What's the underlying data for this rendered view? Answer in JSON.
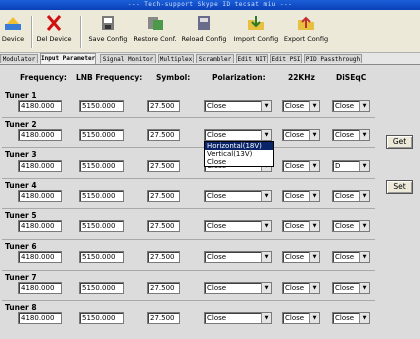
{
  "window": {
    "title": "--- Tech-support Skype ID tecsat miu ---"
  },
  "toolbar": [
    {
      "label": "Device",
      "icon": "add-device-icon"
    },
    {
      "label": "Del Device",
      "icon": "delete-device-icon"
    },
    {
      "label": "Save Config",
      "icon": "save-config-icon"
    },
    {
      "label": "Restore Conf.",
      "icon": "restore-config-icon"
    },
    {
      "label": "Reload Config",
      "icon": "reload-config-icon"
    },
    {
      "label": "Import Config",
      "icon": "import-config-icon"
    },
    {
      "label": "Export Config",
      "icon": "export-config-icon"
    }
  ],
  "tabs": [
    "Modulator",
    "Input Parameter",
    "Signal Monitor",
    "Multiplex",
    "Scrambler",
    "Edit NIT",
    "Edit PSI",
    "PID Passthrough"
  ],
  "active_tab": "Input Parameter",
  "headers": {
    "frequency": "Frequency:",
    "lnb": "LNB Frequency:",
    "symbol": "Symbol:",
    "polarization": "Polarization:",
    "khz": "22KHz",
    "diseqc": "DiSEqC"
  },
  "tuners": [
    {
      "label": "Tuner 1",
      "frequency": "4180.000",
      "lnb": "5150.000",
      "symbol": "27.500",
      "polarization": "Close",
      "khz": "Close",
      "diseqc": "Close"
    },
    {
      "label": "Tuner 2",
      "frequency": "4180.000",
      "lnb": "5150.000",
      "symbol": "27.500",
      "polarization": "Close",
      "khz": "Close",
      "diseqc": "Close"
    },
    {
      "label": "Tuner 3",
      "frequency": "4180.000",
      "lnb": "5150.000",
      "symbol": "27.500",
      "polarization": "Close",
      "khz": "Close",
      "diseqc": "D"
    },
    {
      "label": "Tuner 4",
      "frequency": "4180.000",
      "lnb": "5150.000",
      "symbol": "27.500",
      "polarization": "Close",
      "khz": "Close",
      "diseqc": "Close"
    },
    {
      "label": "Tuner 5",
      "frequency": "4180.000",
      "lnb": "5150.000",
      "symbol": "27.500",
      "polarization": "Close",
      "khz": "Close",
      "diseqc": "Close"
    },
    {
      "label": "Tuner 6",
      "frequency": "4180.000",
      "lnb": "5150.000",
      "symbol": "27.500",
      "polarization": "Close",
      "khz": "Close",
      "diseqc": "Close"
    },
    {
      "label": "Tuner 7",
      "frequency": "4180.000",
      "lnb": "5150.000",
      "symbol": "27.500",
      "polarization": "Close",
      "khz": "Close",
      "diseqc": "Close"
    },
    {
      "label": "Tuner 8",
      "frequency": "4180.000",
      "lnb": "5150.000",
      "symbol": "27.500",
      "polarization": "Close",
      "khz": "Close",
      "diseqc": "Close"
    }
  ],
  "dropdown": {
    "for_tuner": "Tuner 2",
    "options": [
      "Horizontal(18V)",
      "Vertical(13V)",
      "Close"
    ],
    "highlighted": "Horizontal(18V)"
  },
  "buttons": {
    "get": "Get",
    "set": "Set"
  }
}
